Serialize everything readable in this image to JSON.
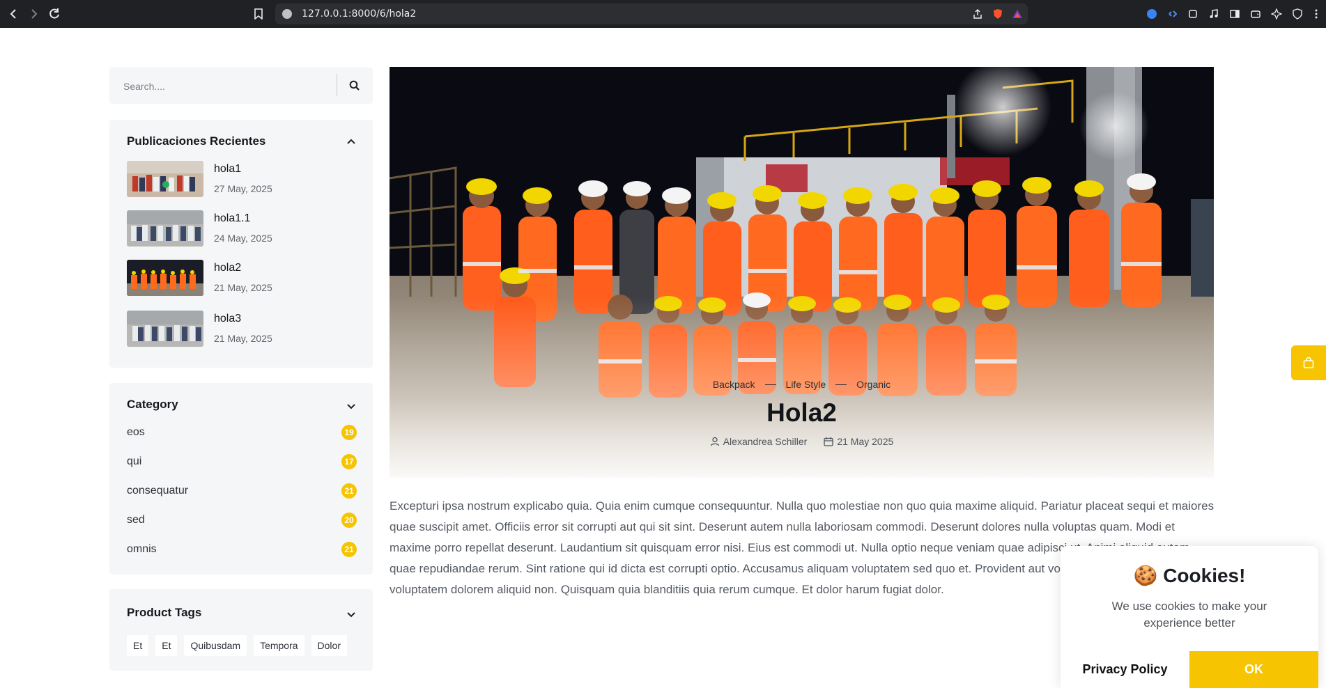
{
  "browser": {
    "url": "127.0.0.1:8000/6/hola2"
  },
  "search": {
    "placeholder": "Search...."
  },
  "recent": {
    "title": "Publicaciones Recientes",
    "items": [
      {
        "title": "hola1",
        "date": "27 May, 2025"
      },
      {
        "title": "hola1.1",
        "date": "24 May, 2025"
      },
      {
        "title": "hola2",
        "date": "21 May, 2025"
      },
      {
        "title": "hola3",
        "date": "21 May, 2025"
      }
    ]
  },
  "category": {
    "title": "Category",
    "items": [
      {
        "name": "eos",
        "count": "19"
      },
      {
        "name": "qui",
        "count": "17"
      },
      {
        "name": "consequatur",
        "count": "21"
      },
      {
        "name": "sed",
        "count": "20"
      },
      {
        "name": "omnis",
        "count": "21"
      }
    ]
  },
  "tags": {
    "title": "Product Tags",
    "items": [
      "Et",
      "Et",
      "Quibusdam",
      "Tempora",
      "Dolor"
    ]
  },
  "post": {
    "breadcrumbs": [
      "Backpack",
      "Life Style",
      "Organic"
    ],
    "title": "Hola2",
    "author": "Alexandrea Schiller",
    "date": "21 May 2025",
    "body": "Excepturi ipsa nostrum explicabo quia. Quia enim cumque consequuntur. Nulla quo molestiae non quo quia maxime aliquid. Pariatur placeat sequi et maiores quae suscipit amet. Officiis error sit corrupti aut qui sit sint. Deserunt autem nulla laboriosam commodi. Deserunt dolores nulla voluptas quam. Modi et maxime porro repellat deserunt. Laudantium sit quisquam error nisi. Eius est commodi ut. Nulla optio neque veniam quae adipisci ut. Animi aliquid autem quae repudiandae rerum. Sint ratione qui id dicta est corrupti optio. Accusamus aliquam voluptatem sed quo et. Provident aut voluptas quam dolore voluptatem dolorem aliquid non. Quisquam quia blanditiis quia rerum cumque. Et dolor harum fugiat dolor."
  },
  "cookie": {
    "emoji": "🍪",
    "title": "Cookies!",
    "text": "We use cookies to make your experience better",
    "policy_label": "Privacy Policy",
    "ok_label": "OK"
  },
  "colors": {
    "accent": "#f6c400",
    "sidebar_bg": "#f5f6f7",
    "browser_bg": "#202124"
  },
  "icons": {
    "back": "chevron-left-icon",
    "forward": "chevron-right-icon",
    "reload": "reload-icon",
    "bookmark": "bookmark-icon",
    "share": "share-icon",
    "search": "search-icon",
    "cart": "shopping-bag-icon",
    "user": "user-icon",
    "calendar": "calendar-icon"
  }
}
